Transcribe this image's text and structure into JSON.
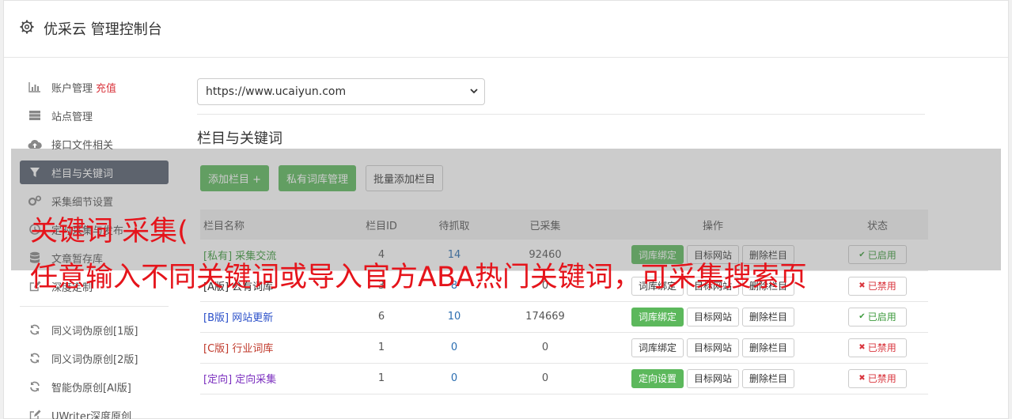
{
  "header": {
    "title": "优采云 管理控制台",
    "icon": "gear-icon"
  },
  "sidebar": {
    "items": [
      {
        "label": "账户管理",
        "icon": "bar-chart-icon",
        "extra": "充值"
      },
      {
        "label": "站点管理",
        "icon": "server-icon"
      },
      {
        "label": "接口文件相关",
        "icon": "cloud-upload-icon"
      },
      {
        "label": "栏目与关键词",
        "icon": "filter-icon",
        "active": true
      },
      {
        "label": "采集细节设置",
        "icon": "cogs-icon"
      },
      {
        "label": "定时采集与发布",
        "icon": "clock-icon"
      },
      {
        "label": "文章暂存库",
        "icon": "database-icon"
      },
      {
        "label": "深度定制",
        "icon": "edit-icon"
      }
    ],
    "items2": [
      {
        "label": "同义词伪原创[1版]",
        "icon": "refresh-icon"
      },
      {
        "label": "同义词伪原创[2版]",
        "icon": "refresh-icon"
      },
      {
        "label": "智能伪原创[AI版]",
        "icon": "refresh-icon"
      },
      {
        "label": "UWriter深度原创",
        "icon": "edit-icon"
      }
    ]
  },
  "main": {
    "site_select": "https://www.ucaiyun.com",
    "section_title": "栏目与关键词",
    "buttons": {
      "add": "添加栏目 +",
      "private_lib": "私有词库管理",
      "batch_add": "批量添加栏目"
    },
    "table": {
      "headers": [
        "栏目名称",
        "栏目ID",
        "待抓取",
        "已采集",
        "操作",
        "状态"
      ],
      "rows": [
        {
          "name": "[私有] 采集交流",
          "color": "#3c9a3c",
          "id": "4",
          "pending": "14",
          "done": "92460",
          "op1": "词库绑定",
          "op1_green": true,
          "op2": "目标网站",
          "op3": "删除栏目",
          "status": "已启用",
          "on": true
        },
        {
          "name": "[A版] 公有词库",
          "color": "#333333",
          "id": "3",
          "pending": "8",
          "done": "0",
          "op1": "词库绑定",
          "op1_green": false,
          "op2": "目标网站",
          "op3": "删除栏目",
          "status": "已禁用",
          "on": false
        },
        {
          "name": "[B版] 网站更新",
          "color": "#2a4fc9",
          "id": "6",
          "pending": "10",
          "done": "174669",
          "op1": "词库绑定",
          "op1_green": true,
          "op2": "目标网站",
          "op3": "删除栏目",
          "status": "已启用",
          "on": true
        },
        {
          "name": "[C版] 行业词库",
          "color": "#c0392b",
          "id": "1",
          "pending": "0",
          "done": "0",
          "op1": "词库绑定",
          "op1_green": false,
          "op2": "目标网站",
          "op3": "删除栏目",
          "status": "已禁用",
          "on": false
        },
        {
          "name": "[定向] 定向采集",
          "color": "#7b2fbf",
          "id": "1",
          "pending": "0",
          "done": "0",
          "op1": "定向设置",
          "op1_green": true,
          "op2": "目标网站",
          "op3": "删除栏目",
          "status": "已禁用",
          "on": false
        }
      ]
    }
  },
  "overlay": {
    "line1": "关键词 采集(",
    "line2": "任意输入不同关键词或导入官方ABA热门关键词，可采集搜索页"
  }
}
